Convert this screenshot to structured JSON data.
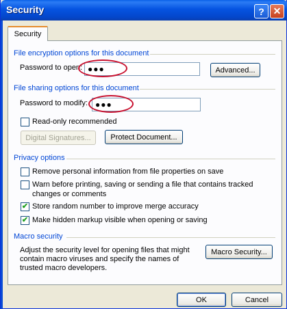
{
  "window": {
    "title": "Security",
    "help_glyph": "?",
    "close_glyph": "✕"
  },
  "tabs": [
    {
      "label": "Security",
      "selected": true
    }
  ],
  "file_encryption": {
    "heading": "File encryption options for this document",
    "password_label": "Password to open:",
    "password_value": "●●●",
    "advanced_button": "Advanced..."
  },
  "file_sharing": {
    "heading": "File sharing options for this document",
    "password_label": "Password to modify:",
    "password_value": "●●●",
    "readonly_label": "Read-only recommended",
    "readonly_checked": false,
    "digital_signatures_button": "Digital Signatures...",
    "protect_document_button": "Protect Document..."
  },
  "privacy": {
    "heading": "Privacy options",
    "options": [
      {
        "label": "Remove personal information from file properties on save",
        "checked": false
      },
      {
        "label": "Warn before printing, saving or sending a file that contains tracked",
        "label_line2": "changes or comments",
        "checked": false
      },
      {
        "label": "Store random number to improve merge accuracy",
        "checked": true
      },
      {
        "label": "Make hidden markup visible when opening or saving",
        "checked": true
      }
    ]
  },
  "macro": {
    "heading": "Macro security",
    "description_line1": "Adjust the security level for opening files that might",
    "description_line2": "contain macro viruses and specify the names of",
    "description_line3": "trusted macro developers.",
    "macro_security_button": "Macro Security..."
  },
  "footer": {
    "ok_button": "OK",
    "cancel_button": "Cancel"
  },
  "colors": {
    "title_bar": "#0553e1",
    "section_heading": "#0046d5",
    "annotation": "#c8102e",
    "checkmark": "#21a121"
  }
}
